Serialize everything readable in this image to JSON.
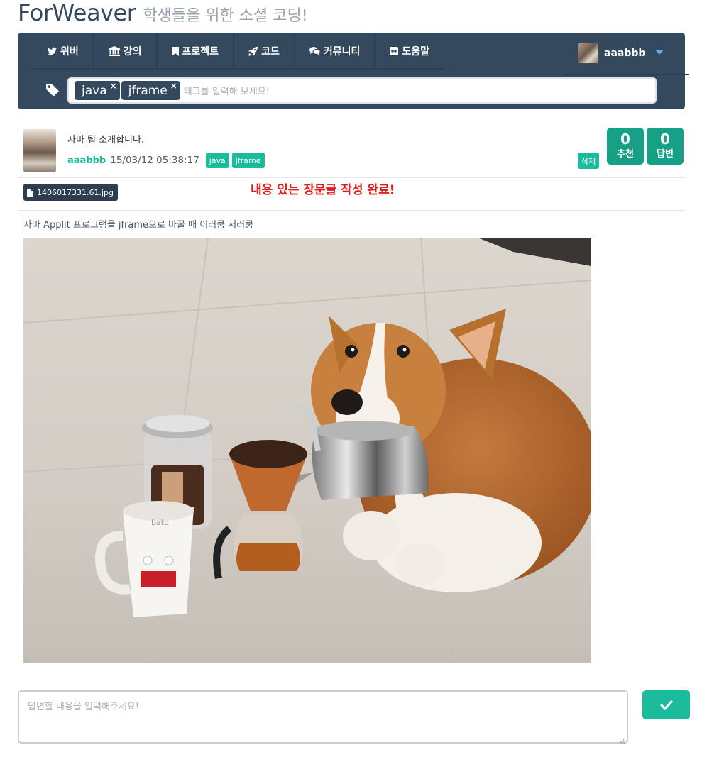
{
  "brand": {
    "name": "ForWeaver",
    "tagline": "학생들을 위한 소셜 코딩!"
  },
  "nav": {
    "items": [
      {
        "label": "위버",
        "icon": "twitter-icon"
      },
      {
        "label": "강의",
        "icon": "bank-icon"
      },
      {
        "label": "프로젝트",
        "icon": "bookmark-icon"
      },
      {
        "label": "코드",
        "icon": "rocket-icon"
      },
      {
        "label": "커뮤니티",
        "icon": "chat-bubbles-icon"
      },
      {
        "label": "도움말",
        "icon": "help-icon"
      }
    ],
    "user": {
      "name": "aaabbb"
    }
  },
  "tag_input": {
    "tags": [
      "java",
      "jframe"
    ],
    "remove_symbol": "×",
    "placeholder": "태그를 입력해 보세요!"
  },
  "post": {
    "title": "자바 팁 소개합니다.",
    "author": "aaabbb",
    "date": "15/03/12 05:38:17",
    "tags": [
      "java",
      "jframe"
    ],
    "delete_label": "삭제",
    "likes": {
      "count": "0",
      "label": "추천"
    },
    "replies": {
      "count": "0",
      "label": "답변"
    },
    "attachment": "1406017331.61.jpg",
    "headline": "내용 있는 장문글 작성 완료!",
    "body": "자바 Applit 프로그램을 jframe으로 바꿀 때 이러쿵 저러쿵",
    "image_caption": "bato"
  },
  "answer": {
    "placeholder": "답변할 내용을 입력해주세요!"
  },
  "colors": {
    "navbar": "#34495e",
    "accent": "#1abc9c",
    "accent_dark": "#16a085",
    "headline": "#e01e1e",
    "tagline": "#9aa4ae"
  }
}
